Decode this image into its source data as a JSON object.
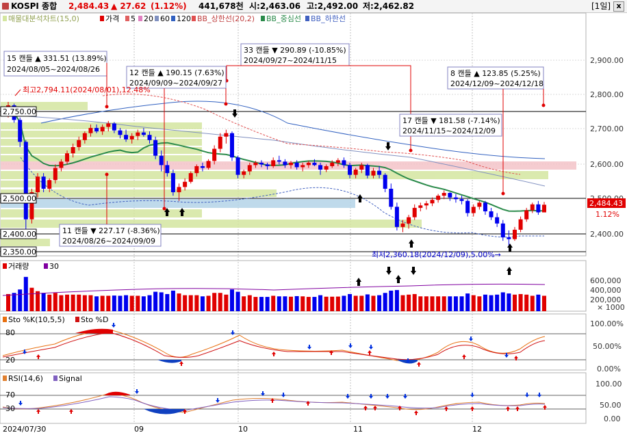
{
  "header": {
    "symbol": "KOSPI 종합",
    "price": "2,484.43",
    "change": "▲ 27.62",
    "change_pct": "(1.12%)",
    "volume": "441,678천",
    "open": "시:2,463.06",
    "high": "고:2,492.00",
    "low": "저:2,462.82",
    "period": "[1일]",
    "close_icon": "x"
  },
  "colors": {
    "up": "#e00000",
    "down": "#0000ee",
    "ma20": "#2a8a4a",
    "bb_band": "#e05050",
    "volume_ma": "#8000a0",
    "stoch_k": "#e87010",
    "stoch_d": "#d01010",
    "rsi": "#e08030",
    "signal": "#8060c0",
    "zone_green": "#d4e6a0",
    "zone_pink": "#f4c4c8",
    "zone_blue": "#b4d4e8"
  },
  "chart_data": [
    {
      "type": "candlestick",
      "title": "",
      "legend": [
        "매물대분석차트(15,0)",
        "가격",
        "5",
        "20",
        "60",
        "120",
        "BB_상한선(20,2)",
        "BB_중심선",
        "BB_하한선"
      ],
      "ylim": [
        2340,
        2960
      ],
      "yticks": [
        "2,900.00",
        "2,800.00",
        "2,700.00",
        "2,600.00",
        "2,500.00",
        "2,400.00"
      ],
      "price_labels": [
        "2,750.00",
        "2,500.00",
        "2,400.00",
        "2,350.00"
      ],
      "x_labels": [
        "2024/07/30",
        "09",
        "10",
        "11",
        "12"
      ],
      "last_price_label": "2,484.43",
      "last_change_label": "1.12%",
      "ohlc": [
        [
          2740,
          2780,
          2735,
          2770
        ],
        [
          2770,
          2775,
          2720,
          2728
        ],
        [
          2728,
          2735,
          2650,
          2665
        ],
        [
          2665,
          2670,
          2385,
          2442
        ],
        [
          2442,
          2530,
          2430,
          2520
        ],
        [
          2520,
          2575,
          2505,
          2565
        ],
        [
          2565,
          2575,
          2520,
          2530
        ],
        [
          2530,
          2560,
          2520,
          2555
        ],
        [
          2555,
          2600,
          2545,
          2590
        ],
        [
          2590,
          2615,
          2580,
          2608
        ],
        [
          2608,
          2640,
          2600,
          2632
        ],
        [
          2632,
          2660,
          2620,
          2650
        ],
        [
          2650,
          2680,
          2640,
          2670
        ],
        [
          2670,
          2695,
          2660,
          2690
        ],
        [
          2690,
          2715,
          2680,
          2705
        ],
        [
          2705,
          2715,
          2690,
          2695
        ],
        [
          2695,
          2715,
          2685,
          2708
        ],
        [
          2708,
          2725,
          2695,
          2718
        ],
        [
          2718,
          2722,
          2690,
          2698
        ],
        [
          2698,
          2705,
          2675,
          2685
        ],
        [
          2685,
          2700,
          2665,
          2672
        ],
        [
          2672,
          2690,
          2660,
          2682
        ],
        [
          2682,
          2700,
          2670,
          2692
        ],
        [
          2692,
          2705,
          2680,
          2685
        ],
        [
          2685,
          2695,
          2660,
          2670
        ],
        [
          2670,
          2680,
          2615,
          2625
        ],
        [
          2625,
          2640,
          2580,
          2598
        ],
        [
          2598,
          2610,
          2565,
          2575
        ],
        [
          2575,
          2585,
          2510,
          2520
        ],
        [
          2520,
          2545,
          2495,
          2535
        ],
        [
          2535,
          2560,
          2525,
          2550
        ],
        [
          2550,
          2580,
          2545,
          2575
        ],
        [
          2575,
          2600,
          2565,
          2595
        ],
        [
          2595,
          2605,
          2580,
          2590
        ],
        [
          2590,
          2615,
          2585,
          2610
        ],
        [
          2610,
          2655,
          2600,
          2645
        ],
        [
          2645,
          2690,
          2635,
          2680
        ],
        [
          2680,
          2700,
          2660,
          2690
        ],
        [
          2690,
          2695,
          2610,
          2620
        ],
        [
          2620,
          2625,
          2560,
          2570
        ],
        [
          2570,
          2585,
          2560,
          2580
        ],
        [
          2580,
          2605,
          2570,
          2598
        ],
        [
          2598,
          2610,
          2590,
          2605
        ],
        [
          2605,
          2612,
          2592,
          2600
        ],
        [
          2600,
          2605,
          2585,
          2595
        ],
        [
          2595,
          2620,
          2590,
          2612
        ],
        [
          2612,
          2625,
          2600,
          2608
        ],
        [
          2608,
          2615,
          2590,
          2598
        ],
        [
          2598,
          2610,
          2588,
          2605
        ],
        [
          2605,
          2612,
          2585,
          2592
        ],
        [
          2592,
          2605,
          2580,
          2598
        ],
        [
          2598,
          2610,
          2590,
          2605
        ],
        [
          2605,
          2615,
          2595,
          2598
        ],
        [
          2598,
          2605,
          2570,
          2585
        ],
        [
          2585,
          2600,
          2578,
          2595
        ],
        [
          2595,
          2612,
          2590,
          2605
        ],
        [
          2605,
          2618,
          2595,
          2612
        ],
        [
          2612,
          2620,
          2590,
          2598
        ],
        [
          2598,
          2605,
          2560,
          2570
        ],
        [
          2570,
          2590,
          2560,
          2585
        ],
        [
          2585,
          2605,
          2575,
          2598
        ],
        [
          2598,
          2602,
          2560,
          2568
        ],
        [
          2568,
          2590,
          2560,
          2582
        ],
        [
          2582,
          2595,
          2560,
          2570
        ],
        [
          2570,
          2575,
          2520,
          2530
        ],
        [
          2530,
          2545,
          2470,
          2478
        ],
        [
          2478,
          2490,
          2410,
          2420
        ],
        [
          2420,
          2440,
          2405,
          2430
        ],
        [
          2430,
          2455,
          2415,
          2448
        ],
        [
          2448,
          2485,
          2440,
          2475
        ],
        [
          2475,
          2490,
          2465,
          2482
        ],
        [
          2482,
          2495,
          2470,
          2488
        ],
        [
          2488,
          2505,
          2480,
          2498
        ],
        [
          2498,
          2515,
          2490,
          2510
        ],
        [
          2510,
          2525,
          2500,
          2518
        ],
        [
          2518,
          2520,
          2495,
          2505
        ],
        [
          2505,
          2515,
          2490,
          2500
        ],
        [
          2500,
          2510,
          2485,
          2495
        ],
        [
          2495,
          2500,
          2450,
          2460
        ],
        [
          2460,
          2485,
          2450,
          2478
        ],
        [
          2478,
          2495,
          2470,
          2490
        ],
        [
          2490,
          2495,
          2455,
          2465
        ],
        [
          2465,
          2475,
          2440,
          2448
        ],
        [
          2448,
          2460,
          2420,
          2430
        ],
        [
          2430,
          2440,
          2380,
          2390
        ],
        [
          2390,
          2410,
          2360,
          2385
        ],
        [
          2385,
          2420,
          2380,
          2412
        ],
        [
          2412,
          2450,
          2405,
          2442
        ],
        [
          2442,
          2475,
          2435,
          2468
        ],
        [
          2468,
          2490,
          2460,
          2485
        ],
        [
          2485,
          2495,
          2455,
          2462
        ],
        [
          2462,
          2492,
          2462,
          2484
        ]
      ],
      "annotations": [
        {
          "text": "15 캔들 ▲ 331.51 (13.89%)",
          "range": "2024/08/05~2024/08/26"
        },
        {
          "text": "33 캔들 ▼ 290.89 (-10.85%)",
          "range": "2024/09/27~2024/11/15"
        },
        {
          "text": "12 캔들 ▲ 190.15 (7.63%)",
          "range": "2024/09/09~2024/09/27"
        },
        {
          "text": "8 캔들 ▲ 123.85 (5.25%)",
          "range": "2024/12/09~2024/12/18"
        },
        {
          "text": "17 캔들 ▼ 181.58 (-7.14%)",
          "range": "2024/11/15~2024/12/09"
        },
        {
          "text": "11 캔들 ▼ 227.17 (-8.36%)",
          "range": "2024/08/26~2024/09/09"
        }
      ],
      "max_label": "최고2,794.11(2024/08/01),12.48%",
      "min_label": "최저2,360.18(2024/12/09),5.00%→"
    },
    {
      "type": "bar",
      "legend": [
        "거래량",
        "30"
      ],
      "yticks": [
        "600,000",
        "400,000",
        "200,000"
      ],
      "unit_label": "× 1000",
      "ylim": [
        0,
        1000000
      ]
    },
    {
      "type": "line",
      "legend": [
        "Sto %K(10,5,5)",
        "Sto %D"
      ],
      "ylim": [
        0,
        100
      ],
      "yticks": [
        "100.00%",
        "50.00%",
        "0.00%"
      ],
      "levels": [
        "80",
        "20"
      ]
    },
    {
      "type": "line",
      "legend": [
        "RSI(14,6)",
        "Signal"
      ],
      "ylim": [
        0,
        100
      ],
      "yticks": [
        "100.00",
        "50.00",
        "0.00"
      ],
      "levels": [
        "70",
        "30"
      ]
    }
  ]
}
